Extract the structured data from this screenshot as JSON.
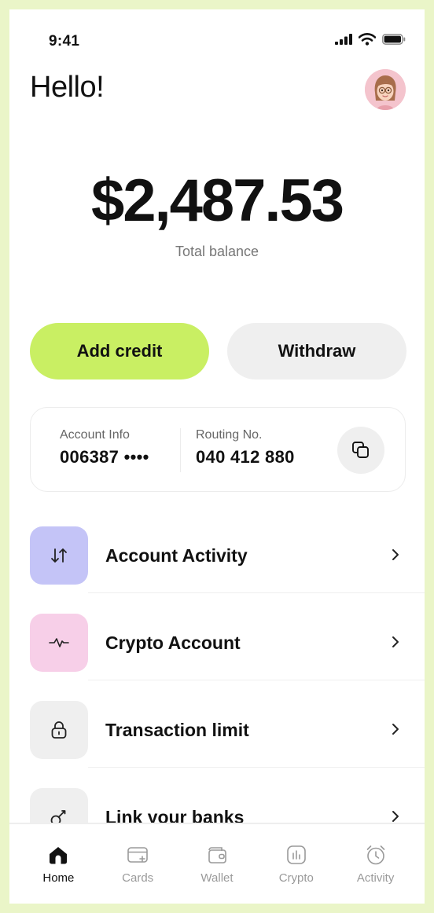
{
  "status_bar": {
    "time": "9:41"
  },
  "header": {
    "greeting": "Hello!"
  },
  "balance": {
    "amount": "$2,487.53",
    "label": "Total balance"
  },
  "actions": {
    "add_credit": "Add credit",
    "withdraw": "Withdraw"
  },
  "account": {
    "info_label": "Account Info",
    "info_value": "006387 ••••",
    "routing_label": "Routing No.",
    "routing_value": "040 412 880"
  },
  "menu": {
    "items": [
      {
        "label": "Account Activity",
        "icon": "arrows-up-down-icon",
        "color": "#c4c4f7"
      },
      {
        "label": "Crypto Account",
        "icon": "pulse-icon",
        "color": "#f7cfe8"
      },
      {
        "label": "Transaction limit",
        "icon": "lock-icon",
        "color": "#efefef"
      },
      {
        "label": "Link your banks",
        "icon": "link-icon",
        "color": "#efefef"
      }
    ]
  },
  "tabbar": {
    "tabs": [
      {
        "label": "Home",
        "icon": "home-icon",
        "active": true
      },
      {
        "label": "Cards",
        "icon": "card-icon"
      },
      {
        "label": "Wallet",
        "icon": "wallet-icon"
      },
      {
        "label": "Crypto",
        "icon": "chart-icon"
      },
      {
        "label": "Activity",
        "icon": "alarm-icon"
      }
    ]
  },
  "colors": {
    "accent": "#c9ef63",
    "background": "#eaf5c8",
    "activity_icon_bg": "#c4c4f7",
    "crypto_icon_bg": "#f7cfe8"
  }
}
